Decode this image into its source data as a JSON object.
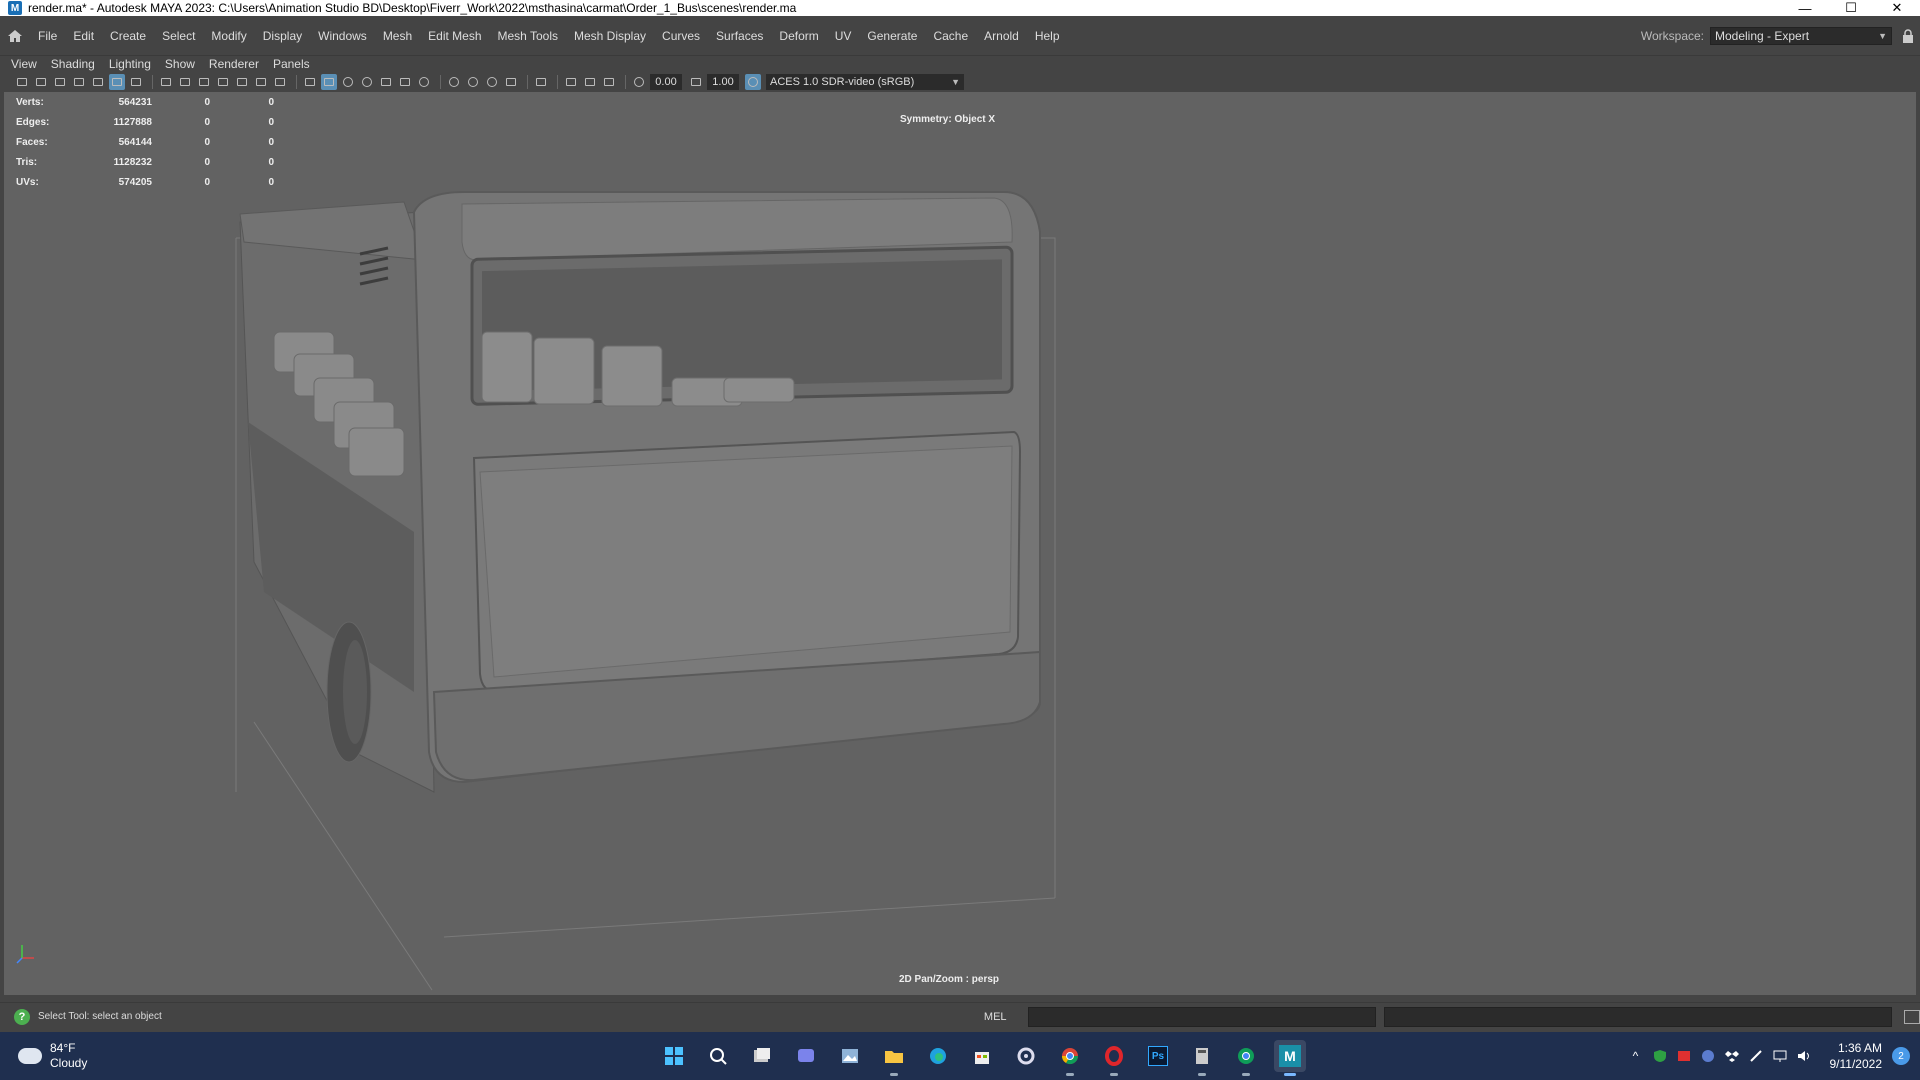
{
  "titlebar": {
    "title": "render.ma* - Autodesk MAYA 2023: C:\\Users\\Animation Studio BD\\Desktop\\Fiverr_Work\\2022\\msthasina\\carmat\\Order_1_Bus\\scenes\\render.ma",
    "app_icon": "M",
    "minimize": "—",
    "maximize": "☐",
    "close": "✕"
  },
  "menubar": {
    "items": [
      "File",
      "Edit",
      "Create",
      "Select",
      "Modify",
      "Display",
      "Windows",
      "Mesh",
      "Edit Mesh",
      "Mesh Tools",
      "Mesh Display",
      "Curves",
      "Surfaces",
      "Deform",
      "UV",
      "Generate",
      "Cache",
      "Arnold",
      "Help"
    ],
    "workspace_label": "Workspace:",
    "workspace_value": "Modeling - Expert"
  },
  "panel_menu": [
    "View",
    "Shading",
    "Lighting",
    "Show",
    "Renderer",
    "Panels"
  ],
  "toolbar": {
    "exposure": "0.00",
    "gamma": "1.00",
    "color_space": "ACES 1.0 SDR-video (sRGB)"
  },
  "hud": {
    "rows": [
      {
        "label": "Verts:",
        "value": "564231",
        "sel": "0",
        "comp": "0"
      },
      {
        "label": "Edges:",
        "value": "1127888",
        "sel": "0",
        "comp": "0"
      },
      {
        "label": "Faces:",
        "value": "564144",
        "sel": "0",
        "comp": "0"
      },
      {
        "label": "Tris:",
        "value": "1128232",
        "sel": "0",
        "comp": "0"
      },
      {
        "label": "UVs:",
        "value": "574205",
        "sel": "0",
        "comp": "0"
      }
    ],
    "symmetry": "Symmetry: Object X",
    "camera": "2D Pan/Zoom : persp"
  },
  "statusbar": {
    "help_text": "Select Tool: select an object",
    "mel_label": "MEL"
  },
  "taskbar": {
    "temperature": "84°F",
    "condition": "Cloudy",
    "time": "1:36 AM",
    "date": "9/11/2022",
    "notifications": "2",
    "apps": [
      "windows-start",
      "search",
      "task-view",
      "teams-chat",
      "photos",
      "file-explorer",
      "edge",
      "store",
      "settings",
      "chrome",
      "opera",
      "photoshop",
      "calculator",
      "chrome-profile",
      "maya"
    ],
    "ps_label": "Ps",
    "maya_label": "M"
  },
  "colors": {
    "viewport_bg": "#626262",
    "ui_bg": "#444444",
    "accent": "#5a8fb5",
    "taskbar": "#1f2f4f"
  }
}
